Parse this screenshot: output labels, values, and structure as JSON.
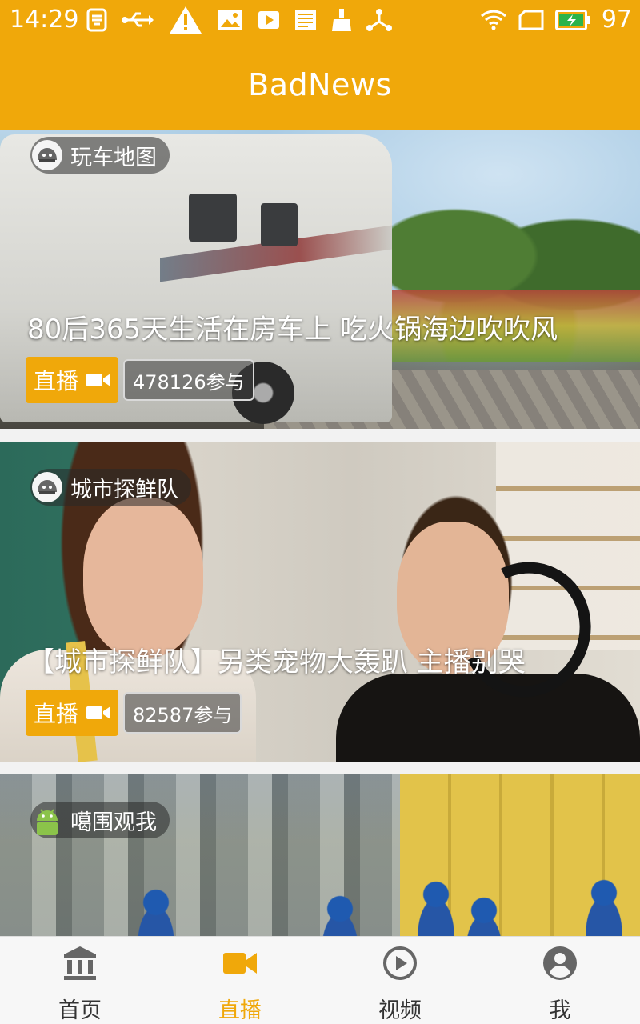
{
  "status_bar": {
    "time": "14:29",
    "battery": "97",
    "icons": [
      "app-icon",
      "usb-icon",
      "warning-icon",
      "image-icon",
      "video-play-icon",
      "news-icon",
      "cleaner-icon",
      "share-icon",
      "wifi-icon",
      "sim-icon",
      "battery-icon"
    ]
  },
  "app_bar": {
    "title": "BadNews"
  },
  "colors": {
    "accent": "#f0a80a"
  },
  "feed": {
    "cards": [
      {
        "tag": "玩车地图",
        "title": "80后365天生活在房车上 吃火锅海边吹吹风",
        "live_label": "直播",
        "participants": "478126参与"
      },
      {
        "tag": "城市探鲜队",
        "title": "【城市探鲜队】另类宠物大轰趴 主播别哭",
        "live_label": "直播",
        "participants": "82587参与"
      },
      {
        "tag": "噶围观我"
      }
    ]
  },
  "tab_bar": {
    "items": [
      {
        "label": "首页",
        "icon": "bank-icon"
      },
      {
        "label": "直播",
        "icon": "video-camera-icon",
        "active": true
      },
      {
        "label": "视频",
        "icon": "play-circle-icon"
      },
      {
        "label": "我",
        "icon": "account-icon"
      }
    ]
  }
}
